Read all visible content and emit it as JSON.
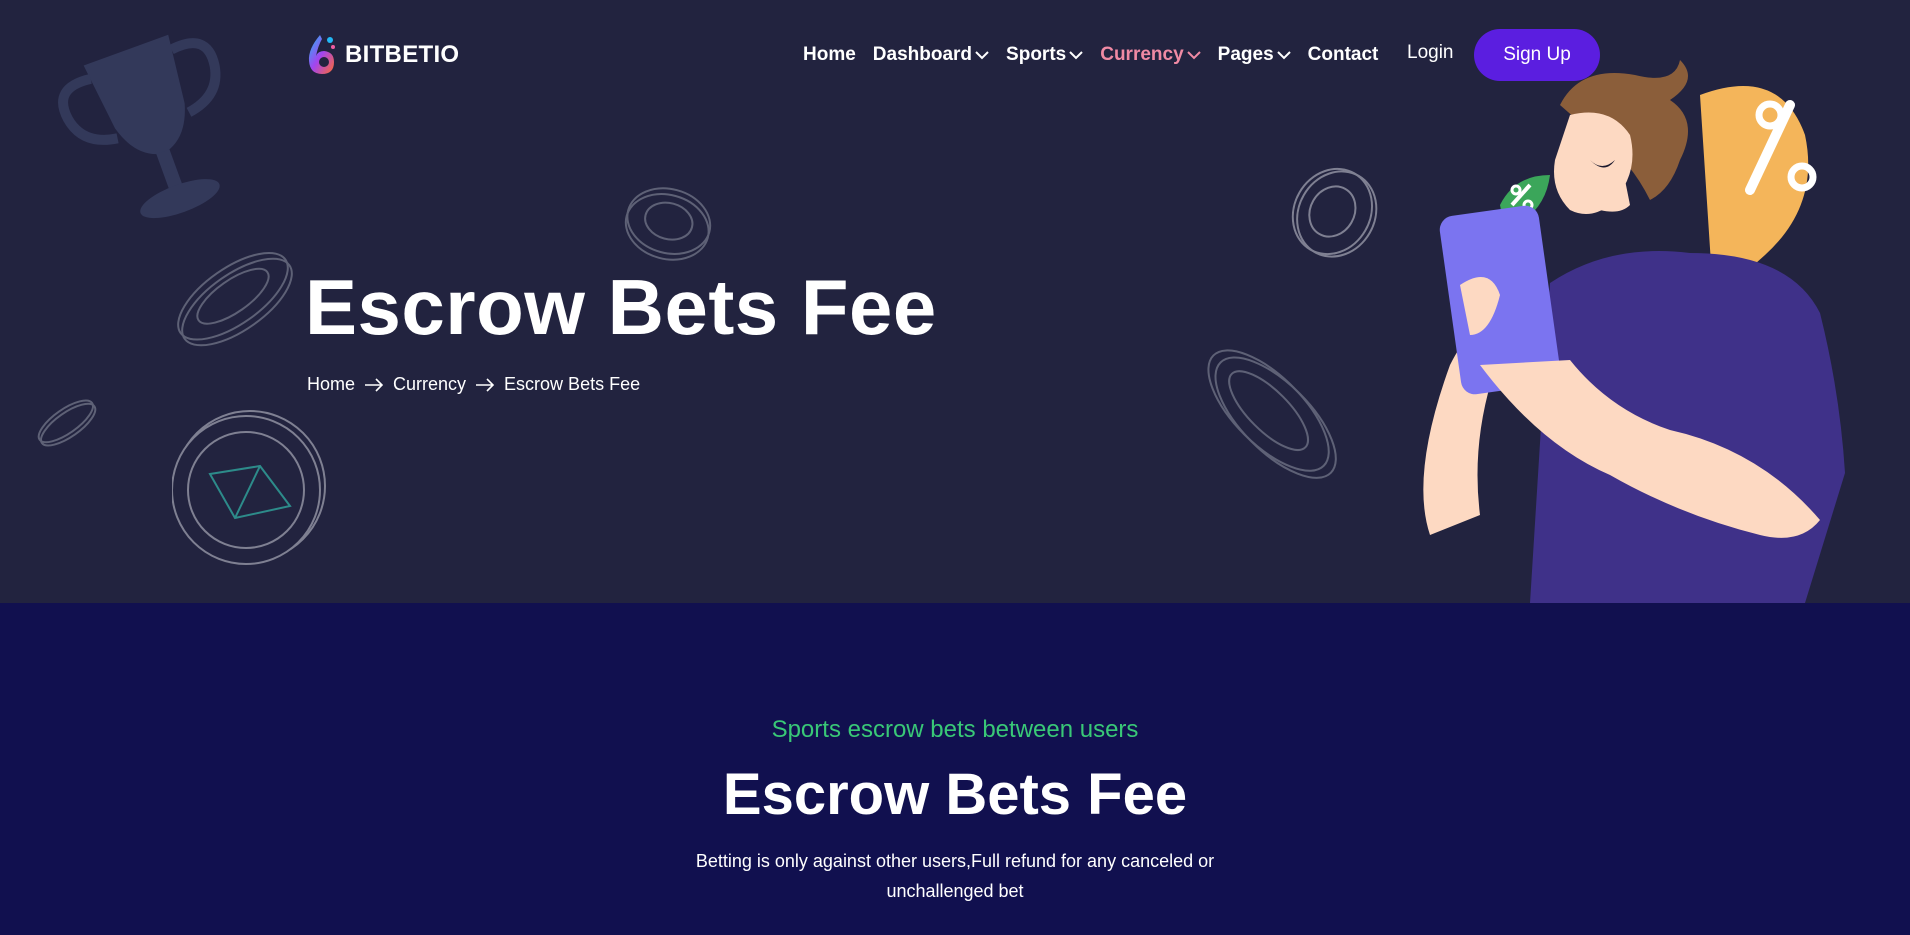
{
  "brand": {
    "name": "BITBETIO"
  },
  "nav": {
    "items": [
      {
        "label": "Home",
        "dropdown": false,
        "active": false
      },
      {
        "label": "Dashboard",
        "dropdown": true,
        "active": false
      },
      {
        "label": "Sports",
        "dropdown": true,
        "active": false
      },
      {
        "label": "Currency",
        "dropdown": true,
        "active": true
      },
      {
        "label": "Pages",
        "dropdown": true,
        "active": false
      },
      {
        "label": "Contact",
        "dropdown": false,
        "active": false
      }
    ],
    "login_label": "Login",
    "signup_label": "Sign Up"
  },
  "hero": {
    "title": "Escrow Bets Fee",
    "breadcrumb": [
      "Home",
      "Currency",
      "Escrow Bets Fee"
    ]
  },
  "section": {
    "eyebrow": "Sports escrow bets between users",
    "title": "Escrow Bets Fee",
    "description": "Betting is only against other users,Full refund for any canceled or unchallenged bet"
  },
  "colors": {
    "hero_bg": "#22233f",
    "section_bg": "#11104f",
    "accent_button": "#5b1ee0",
    "active_nav": "#f08aa4",
    "eyebrow": "#39c877"
  },
  "icons": [
    "logo-icon",
    "chevron-down-icon",
    "arrow-right-icon",
    "trophy-icon",
    "coin-icon",
    "percent-icon"
  ]
}
